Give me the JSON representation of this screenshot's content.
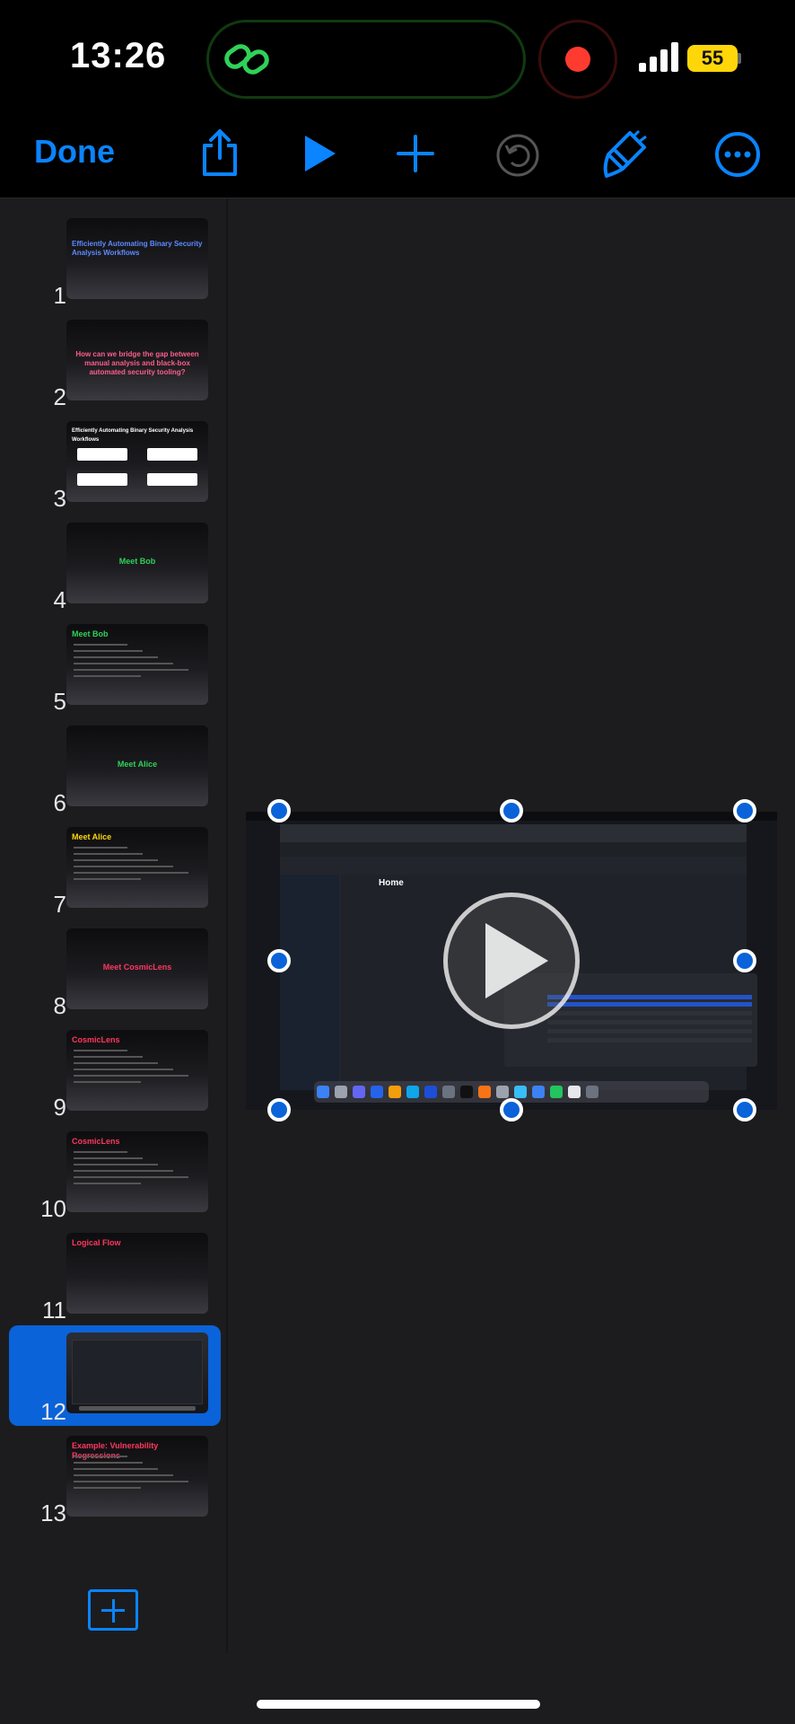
{
  "status_bar": {
    "time": "13:26",
    "battery": "55"
  },
  "toolbar": {
    "done_label": "Done",
    "buttons": [
      "share-icon",
      "play-icon",
      "add-icon",
      "undo-icon",
      "format-brush-icon",
      "more-icon"
    ],
    "accent": "#0a84ff"
  },
  "slides": [
    {
      "number": "1",
      "title": "Efficiently Automating Binary Security Analysis Workflows",
      "color": "#5e8bff"
    },
    {
      "number": "2",
      "title": "How can we bridge the gap between manual analysis and black-box automated security tooling?",
      "color": "#ff5e8a"
    },
    {
      "number": "3",
      "title": "Efficiently Automating Binary Security Analysis Workflows",
      "color": "#ffffff"
    },
    {
      "number": "4",
      "title": "Meet Bob",
      "color": "#30d158"
    },
    {
      "number": "5",
      "title": "Meet Bob",
      "color": "#30d158"
    },
    {
      "number": "6",
      "title": "Meet Alice",
      "color": "#30d158"
    },
    {
      "number": "7",
      "title": "Meet Alice",
      "color": "#ffd60a"
    },
    {
      "number": "8",
      "title": "Meet CosmicLens",
      "color": "#ff375f"
    },
    {
      "number": "9",
      "title": "CosmicLens",
      "color": "#ff375f"
    },
    {
      "number": "10",
      "title": "CosmicLens",
      "color": "#ff375f"
    },
    {
      "number": "11",
      "title": "Logical Flow",
      "color": "#ff375f"
    },
    {
      "number": "12",
      "title": "",
      "color": "#ffffff",
      "selected": true
    },
    {
      "number": "13",
      "title": "Example: Vulnerability Regressions",
      "color": "#ff375f"
    }
  ],
  "canvas": {
    "video_app_title": "Home",
    "selection_color": "#0a63d8"
  }
}
